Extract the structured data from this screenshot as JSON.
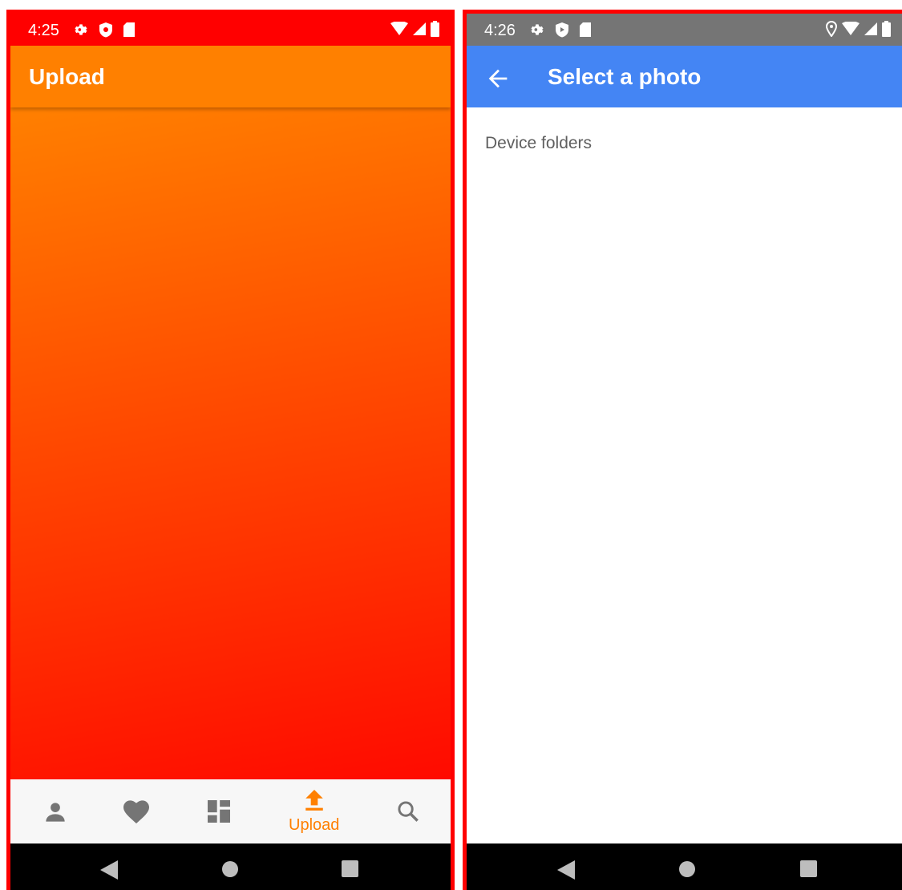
{
  "left_screen": {
    "status_bar": {
      "time": "4:25"
    },
    "app_bar": {
      "title": "Upload"
    },
    "bottom_nav": {
      "items": [
        {
          "icon": "person-icon",
          "label": ""
        },
        {
          "icon": "heart-icon",
          "label": ""
        },
        {
          "icon": "dashboard-icon",
          "label": ""
        },
        {
          "icon": "upload-icon",
          "label": "Upload",
          "active": true
        },
        {
          "icon": "search-icon",
          "label": ""
        }
      ]
    },
    "colors": {
      "status_bar": "#ff0000",
      "app_bar": "#ff8000",
      "gradient_top": "#ff8000",
      "gradient_bottom": "#ff0a00",
      "active_nav": "#ff8000"
    }
  },
  "right_screen": {
    "status_bar": {
      "time": "4:26"
    },
    "app_bar": {
      "title": "Select a photo",
      "back_icon": "arrow-back-icon"
    },
    "content": {
      "section_label": "Device folders"
    },
    "colors": {
      "status_bar": "#757575",
      "app_bar": "#4485f4"
    }
  },
  "system_nav": {
    "buttons": [
      "back-triangle-icon",
      "home-circle-icon",
      "recents-square-icon"
    ]
  }
}
